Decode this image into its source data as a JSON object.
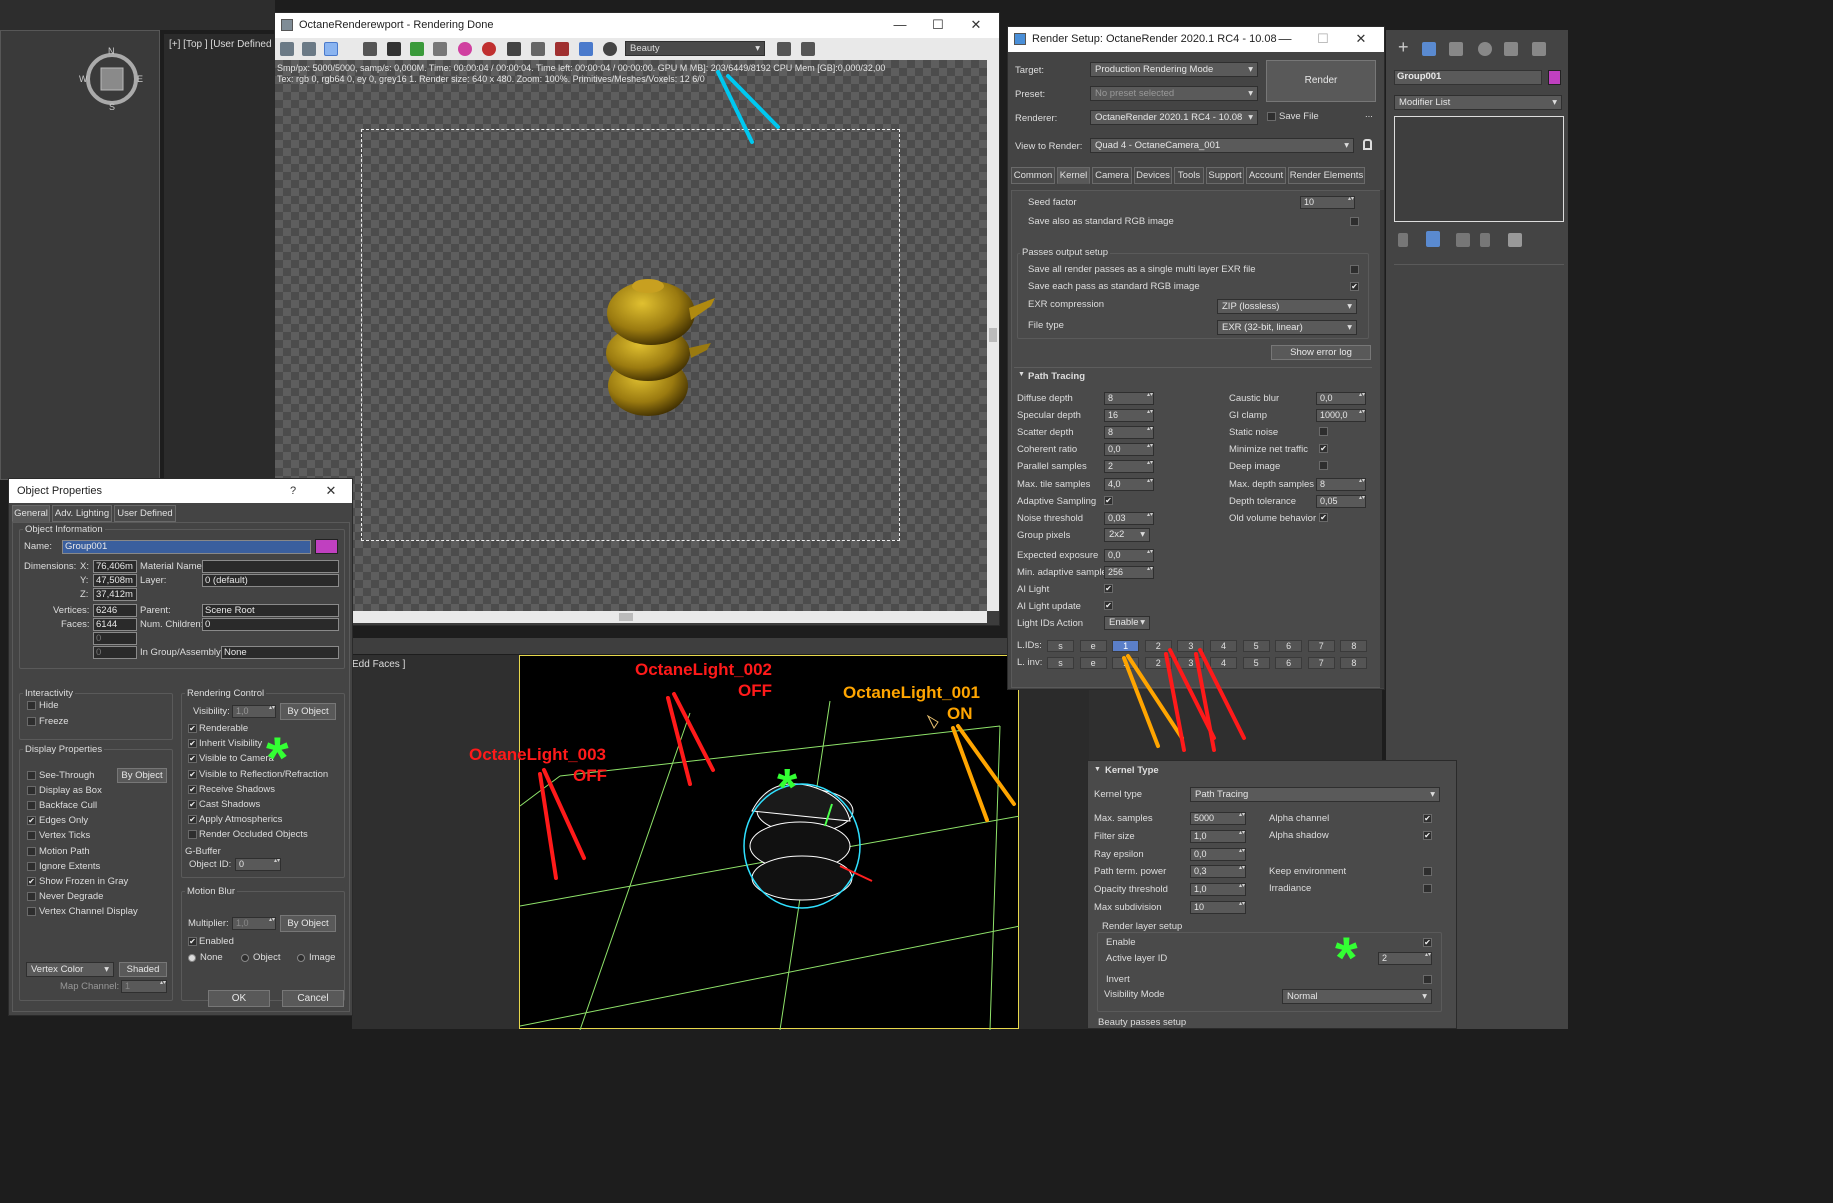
{
  "viewport_top": {
    "label": "[+] [Top ] [User Defined"
  },
  "viewport_bottom": {
    "label": "Edd Faces ]"
  },
  "compass": {
    "n": "N",
    "s": "S",
    "e": "E",
    "w": "W"
  },
  "render_window": {
    "title": "OctaneRenderewport - Rendering Done",
    "channel": "Beauty",
    "status_line1": "Smp/px: 5000/5000, samp/s: 0,000M.   Time: 00:00:04 / 00:00:04.   Time left: 00:00:04 / 00:00:00.   GPU M    MB]: 203/6449/8192   CPU Mem [GB]:0,000/32,00",
    "status_line2": "Tex: rgb 0, rgb64 0, ey 0, grey16 1.   Render size: 640 x 480.   Zoom: 100%.   Primitives/Meshes/Voxels: 12   6/0"
  },
  "render_setup": {
    "title": "Render Setup: OctaneRender 2020.1 RC4 - 10.08",
    "target_label": "Target:",
    "target": "Production Rendering Mode",
    "preset_label": "Preset:",
    "preset": "No preset selected",
    "renderer_label": "Renderer:",
    "renderer": "OctaneRender 2020.1 RC4 - 10.08",
    "render_button": "Render",
    "save_file": "Save File",
    "dots": "...",
    "view_label": "View to Render:",
    "view": "Quad 4 - OctaneCamera_001",
    "tabs": [
      "Common",
      "Kernel",
      "Camera",
      "Devices",
      "Tools",
      "Support",
      "Account",
      "Render Elements"
    ],
    "seed_label": "Seed factor",
    "seed_value": "10",
    "save_rgb": "Save also as standard RGB image",
    "passes_group": "Passes output setup",
    "passes_multi": "Save all render passes as a single multi layer EXR file",
    "passes_each": "Save each pass as standard RGB image",
    "exr_compression_label": "EXR compression",
    "exr_compression": "ZIP (lossless)",
    "file_type_label": "File type",
    "file_type": "EXR (32-bit, linear)",
    "show_error_log": "Show error log",
    "path_tracing_title": "Path Tracing",
    "left_params": [
      {
        "label": "Diffuse depth",
        "value": "8"
      },
      {
        "label": "Specular depth",
        "value": "16"
      },
      {
        "label": "Scatter depth",
        "value": "8"
      },
      {
        "label": "Coherent ratio",
        "value": "0,0"
      },
      {
        "label": "Parallel samples",
        "value": "2"
      },
      {
        "label": "Max. tile samples",
        "value": "4,0"
      },
      {
        "label": "Adaptive Sampling",
        "check": "✔"
      },
      {
        "label": "Noise threshold",
        "value": "0,03"
      },
      {
        "label": "Group pixels",
        "dropdown": "2x2"
      },
      {
        "label": "Expected exposure",
        "value": "0,0"
      },
      {
        "label": "Min. adaptive sample",
        "value": "256"
      },
      {
        "label": "AI Light",
        "check": "✔"
      },
      {
        "label": "AI Light update",
        "check": "✔"
      },
      {
        "label": "Light IDs Action",
        "dropdown": "Enable"
      }
    ],
    "right_params": [
      {
        "label": "Caustic blur",
        "value": "0,0"
      },
      {
        "label": "GI clamp",
        "value": "1000,0"
      },
      {
        "label": "Static noise",
        "check": ""
      },
      {
        "label": "Minimize net traffic",
        "check": "✔"
      },
      {
        "label": "Deep image",
        "check": ""
      },
      {
        "label": "Max. depth samples",
        "value": "8"
      },
      {
        "label": "Depth tolerance",
        "value": "0,05"
      },
      {
        "label": "Old volume behavior",
        "check": "✔"
      }
    ],
    "lids_label": "L.IDs:",
    "linv_label": "L. inv:",
    "light_ids": [
      "s",
      "e",
      "1",
      "2",
      "3",
      "4",
      "5",
      "6",
      "7",
      "8"
    ]
  },
  "right_panel": {
    "object_name": "Group001",
    "modifier_list": "Modifier List"
  },
  "object_properties": {
    "title": "Object Properties",
    "help": "?",
    "tabs": [
      "General",
      "Adv. Lighting",
      "User Defined"
    ],
    "info_group": "Object Information",
    "name_label": "Name:",
    "name": "Group001",
    "dimensions_label": "Dimensions:",
    "x_label": "X:",
    "x": "76,406m",
    "y_label": "Y:",
    "y": "47,508m",
    "z_label": "Z:",
    "z": "37,412m",
    "material_label": "Material Name:",
    "material": "",
    "layer_label": "Layer:",
    "layer": "0 (default)",
    "vertices_label": "Vertices:",
    "vertices": "6246",
    "faces_label": "Faces:",
    "faces": "6144",
    "parent_label": "Parent:",
    "parent": "Scene Root",
    "children_label": "Num. Children:",
    "children": "0",
    "blank1": "0",
    "blank2": "0",
    "group_label": "In Group/Assembly:",
    "group": "None",
    "interactivity_group": "Interactivity",
    "interactivity": [
      {
        "label": "Hide",
        "check": ""
      },
      {
        "label": "Freeze",
        "check": ""
      }
    ],
    "display_group": "Display Properties",
    "display": [
      {
        "label": "See-Through",
        "check": ""
      },
      {
        "label": "Display as Box",
        "check": ""
      },
      {
        "label": "Backface Cull",
        "check": ""
      },
      {
        "label": "Edges Only",
        "check": "✔"
      },
      {
        "label": "Vertex Ticks",
        "check": ""
      },
      {
        "label": "Motion Path",
        "check": ""
      },
      {
        "label": "Ignore Extents",
        "check": ""
      },
      {
        "label": "Show Frozen in Gray",
        "check": "✔"
      },
      {
        "label": "Never Degrade",
        "check": ""
      },
      {
        "label": "Vertex Channel Display",
        "check": ""
      }
    ],
    "by_object": "By Object",
    "vertex_color": "Vertex Color",
    "shaded": "Shaded",
    "map_channel_label": "Map Channel:",
    "map_channel": "1",
    "rendering_group": "Rendering Control",
    "visibility_label": "Visibility:",
    "visibility": "1,0",
    "rendering": [
      {
        "label": "Renderable",
        "check": "✔"
      },
      {
        "label": "Inherit Visibility",
        "check": "✔"
      },
      {
        "label": "Visible to Camera",
        "check": "✔"
      },
      {
        "label": "Visible to Reflection/Refraction",
        "check": "✔"
      },
      {
        "label": "Receive Shadows",
        "check": "✔"
      },
      {
        "label": "Cast Shadows",
        "check": "✔"
      },
      {
        "label": "Apply Atmospherics",
        "check": "✔"
      },
      {
        "label": "Render Occluded Objects",
        "check": ""
      }
    ],
    "gbuffer_group": "G-Buffer",
    "object_id_label": "Object ID:",
    "object_id": "0",
    "motion_group": "Motion Blur",
    "multiplier_label": "Multiplier:",
    "multiplier": "1,0",
    "enabled_label": "Enabled",
    "enabled_check": "✔",
    "radio": [
      "None",
      "Object",
      "Image"
    ],
    "ok": "OK",
    "cancel": "Cancel"
  },
  "kernel_type": {
    "title": "Kernel Type",
    "kernel_label": "Kernel type",
    "kernel": "Path Tracing",
    "params": [
      {
        "label": "Max. samples",
        "value": "5000"
      },
      {
        "label": "Filter size",
        "value": "1,0"
      },
      {
        "label": "Ray epsilon",
        "value": "0,0"
      },
      {
        "label": "Path term. power",
        "value": "0,3"
      },
      {
        "label": "Opacity threshold",
        "value": "1,0"
      },
      {
        "label": "Max subdivision",
        "value": "10"
      }
    ],
    "right": [
      {
        "label": "Alpha channel",
        "check": "✔"
      },
      {
        "label": "Alpha shadow",
        "check": "✔"
      },
      {
        "label": "Keep environment",
        "check": ""
      },
      {
        "label": "Irradiance",
        "check": ""
      }
    ],
    "layer_group": "Render layer setup",
    "enable_label": "Enable",
    "enable_check": "✔",
    "active_layer_label": "Active layer ID",
    "active_layer": "2",
    "invert_label": "Invert",
    "invert_check": "",
    "visibility_mode_label": "Visibility Mode",
    "visibility_mode": "Normal",
    "beauty": "Beauty passes setup"
  },
  "annotations": {
    "light2": "OctaneLight_002",
    "light2_state": "OFF",
    "light1": "OctaneLight_001",
    "light1_state": "ON",
    "light3": "OctaneLight_003",
    "light3_state": "OFF",
    "asterisk": "*"
  },
  "colors": {
    "red": "#ff1a1a",
    "orange": "#ffa500",
    "cyan": "#00c8f0",
    "green": "#33ff33",
    "accent_blue": "#5b7fc9",
    "group_swatch": "#c040c0"
  }
}
